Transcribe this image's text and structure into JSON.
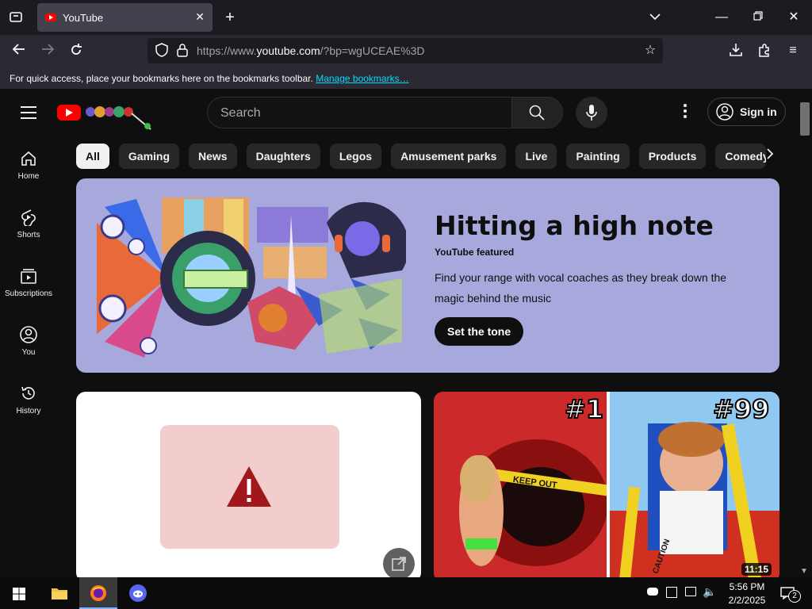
{
  "browser": {
    "tab_title": "YouTube",
    "url_prefix": "https://www.",
    "url_host": "youtube.com",
    "url_rest": "/?bp=wgUCEAE%3D",
    "bookmarks_hint": "For quick access, place your bookmarks here on the bookmarks toolbar.",
    "manage_bookmarks": "Manage bookmarks…"
  },
  "youtube": {
    "search_placeholder": "Search",
    "sign_in": "Sign in",
    "sidebar": [
      {
        "label": "Home",
        "icon": "home-icon"
      },
      {
        "label": "Shorts",
        "icon": "shorts-icon"
      },
      {
        "label": "Subscriptions",
        "icon": "subscriptions-icon"
      },
      {
        "label": "You",
        "icon": "you-icon"
      },
      {
        "label": "History",
        "icon": "history-icon"
      }
    ],
    "chips": [
      "All",
      "Gaming",
      "News",
      "Daughters",
      "Legos",
      "Amusement parks",
      "Live",
      "Painting",
      "Products",
      "Comedy"
    ],
    "banner": {
      "title": "Hitting a high note",
      "featured": "YouTube featured",
      "description": "Find your range with vocal coaches as they break down the magic behind the music",
      "cta": "Set the tone"
    },
    "video2": {
      "badge_left": "#1",
      "badge_right": "#99",
      "duration": "11:15",
      "tape_text": "KEEP OUT",
      "caution_text": "CAUTION"
    }
  },
  "taskbar": {
    "time": "5:56 PM",
    "date": "2/2/2025",
    "notification_count": "2"
  },
  "colors": {
    "youtube_red": "#ff0000",
    "banner_bg": "#a7a9dc",
    "link": "#00ddff"
  }
}
